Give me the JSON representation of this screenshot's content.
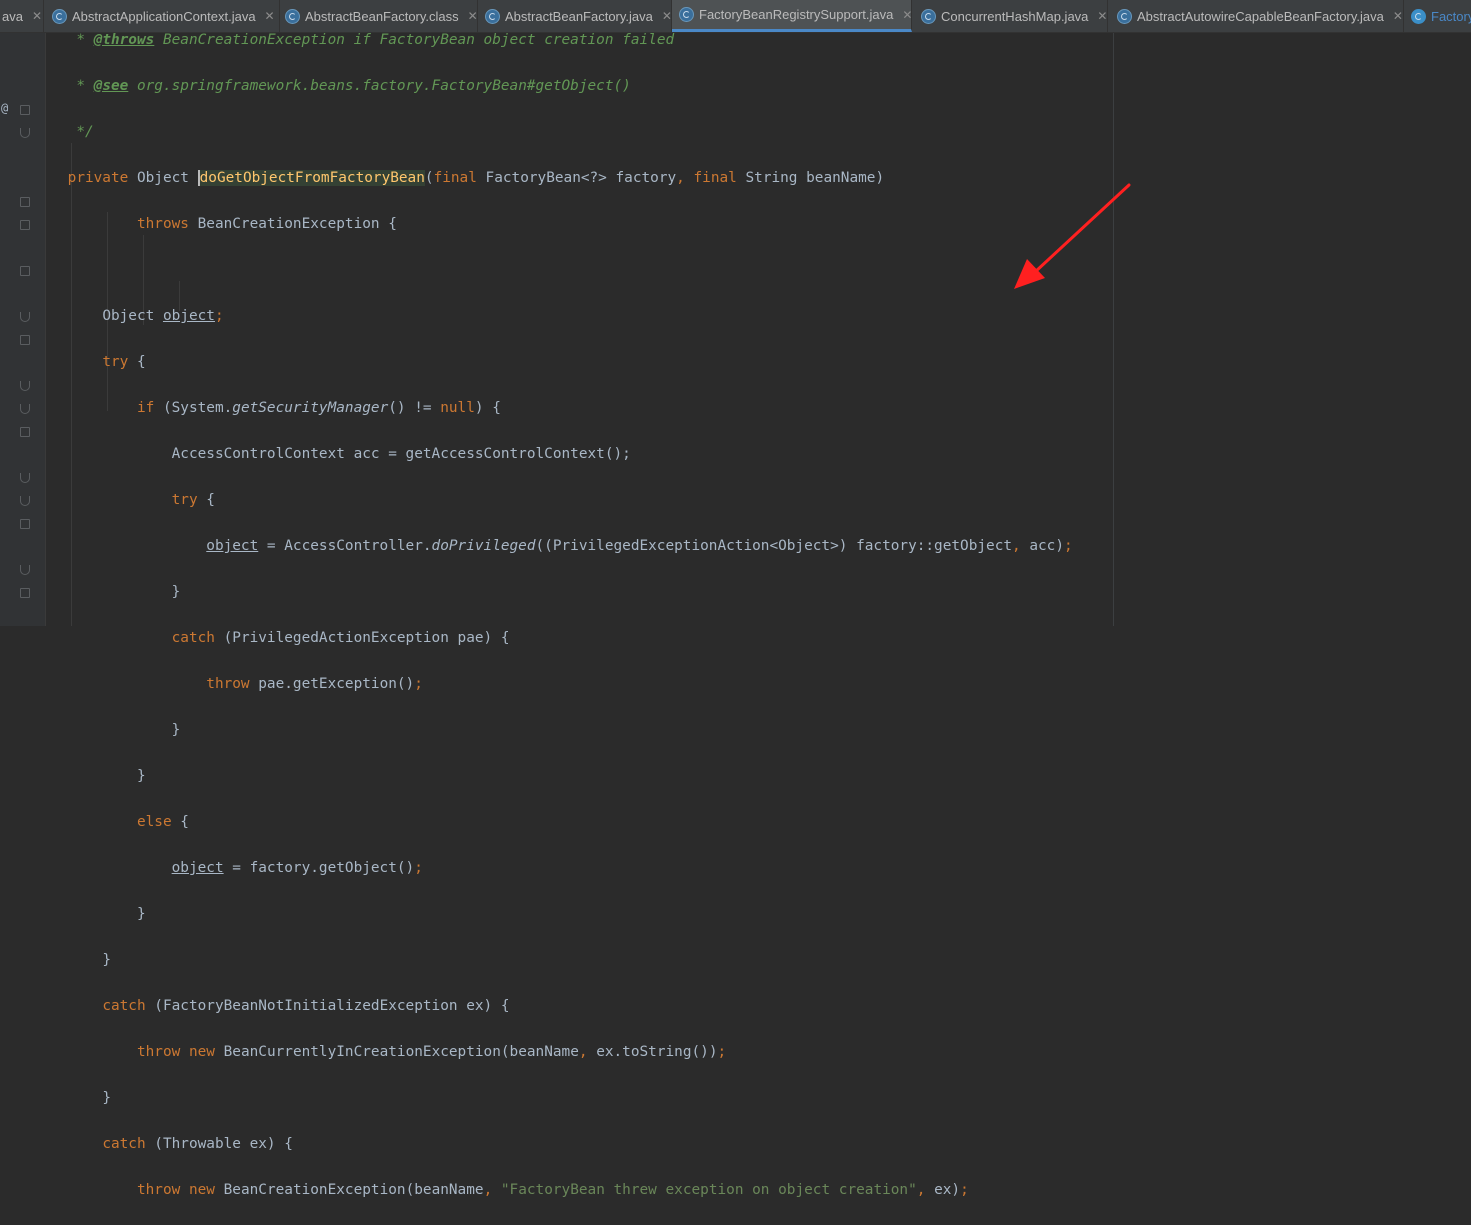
{
  "tabs": [
    {
      "label": "ava",
      "icon": "none",
      "active": false
    },
    {
      "label": "AbstractApplicationContext.java",
      "icon": "java-class-icon",
      "active": false
    },
    {
      "label": "AbstractBeanFactory.class",
      "icon": "java-class-icon",
      "active": false
    },
    {
      "label": "AbstractBeanFactory.java",
      "icon": "java-class-icon",
      "active": false
    },
    {
      "label": "FactoryBeanRegistrySupport.java",
      "icon": "java-class-icon",
      "active": true
    },
    {
      "label": "ConcurrentHashMap.java",
      "icon": "java-class-icon",
      "active": false
    },
    {
      "label": "AbstractAutowireCapableBeanFactory.java",
      "icon": "java-class-icon",
      "active": false
    },
    {
      "label": "Factory",
      "icon": "class-icon",
      "active": false
    }
  ],
  "close_glyph": "✕",
  "gutter_marker": "@",
  "code": {
    "throws_star": "* ",
    "throws_tag": "@throws",
    "throws_text": " BeanCreationException if FactoryBean object creation failed",
    "see_star": "* ",
    "see_tag": "@see",
    "see_text": " org.springframework.beans.factory.FactoryBean#getObject()",
    "comment_end": "*/",
    "private": "private",
    "object_type": " Object ",
    "method_name": "doGetObjectFromFactoryBean",
    "open_paren": "(",
    "final1": "final",
    "param1": " FactoryBean<?> factory",
    "comma1": ", ",
    "final2": "final",
    "param2": " String beanName)",
    "throws_kw": "throws",
    "throws_decl": " BeanCreationException {",
    "obj_decl_type": "Object ",
    "obj_decl_var": "object",
    "semicolon": ";",
    "try1": "try",
    "brace_open": " {",
    "if_kw": "if",
    "if_pre": " (System.",
    "get_security_manager": "getSecurityManager",
    "if_mid": "() != ",
    "null_kw": "null",
    "if_end": ") {",
    "acc_line": "AccessControlContext acc = getAccessControlContext();",
    "try2": "try",
    "do_priv_var": "object",
    "do_priv_pre": " = AccessController.",
    "do_privileged": "doPrivileged",
    "do_priv_post": "((PrivilegedExceptionAction<Object>) factory::getObject",
    "do_priv_comma": ", ",
    "do_priv_end": "acc)",
    "close_brace": "}",
    "catch_kw": "catch",
    "catch1_rest": " (PrivilegedActionException pae) {",
    "throw_kw": "throw",
    "throw1_rest": " pae.getException()",
    "else_kw": "else",
    "else_obj_var": "object",
    "else_rest": " = factory.getObject()",
    "catch2_rest": " (FactoryBeanNotInitializedException ex) {",
    "new_kw": "new",
    "throw2_rest": " BeanCurrentlyInCreationException(beanName",
    "throw2_tail": "ex.toString())",
    "catch3_rest": " (Throwable ex) {",
    "throw3_rest": " BeanCreationException(beanName",
    "throw3_str": "\"FactoryBean threw exception on object creation\"",
    "throw3_tail": "ex)"
  },
  "colors": {
    "background": "#2b2b2b",
    "keyword": "#cc7832",
    "comment": "#629755",
    "string": "#6a8759",
    "method_decl": "#ffc66d",
    "default_text": "#a9b7c6",
    "annotation_arrow": "#ff2020"
  }
}
